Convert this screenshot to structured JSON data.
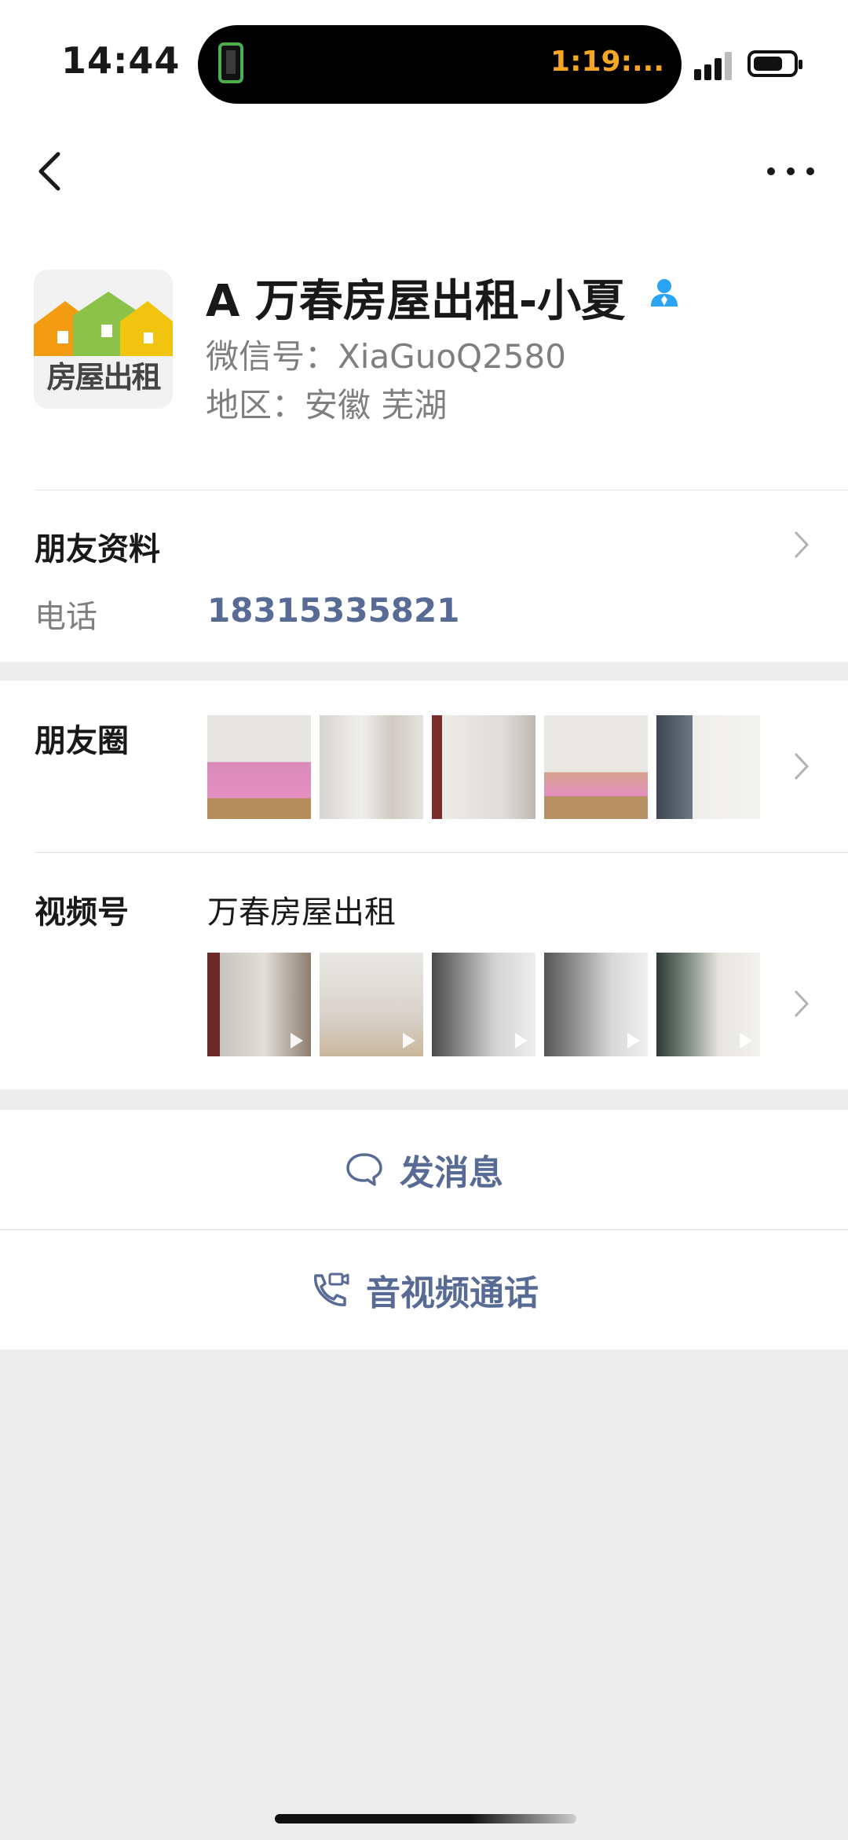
{
  "status_bar": {
    "time": "14:44",
    "call_timer": "1:19:..."
  },
  "profile": {
    "avatar_icon": "house-rental-logo",
    "avatar_text": "房屋出租",
    "name": "A 万春房屋出租-小夏",
    "wechat_id": "微信号：XiaGuoQ2580",
    "region": "地区：安徽 芜湖"
  },
  "friend_info": {
    "title": "朋友资料",
    "phone_label": "电话",
    "phone_number": "18315335821"
  },
  "moments": {
    "title": "朋友圈",
    "photo_count": 5
  },
  "channels": {
    "title": "视频号",
    "channel_name": "万春房屋出租",
    "video_count": 5
  },
  "actions": {
    "message": "发消息",
    "call": "音视频通话"
  },
  "colors": {
    "link": "#576b95",
    "background": "#ededed",
    "accent_timer": "#f5a623",
    "verified_icon": "#2aa4f4"
  }
}
